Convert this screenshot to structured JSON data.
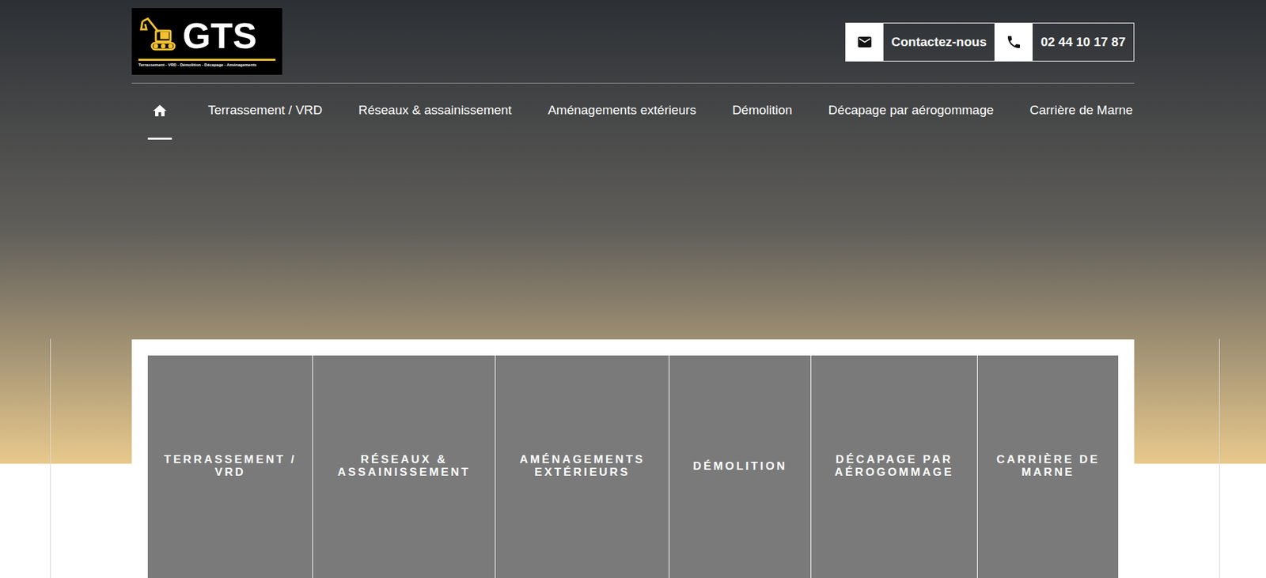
{
  "logo": {
    "name": "GTS",
    "tagline": "Terrassement - VRD - Démolition - Décapage - Aménagements"
  },
  "contact": {
    "email_label": "Contactez-nous",
    "phone": "02 44 10 17 87"
  },
  "nav": {
    "items": [
      {
        "kind": "home",
        "label": "",
        "selected": true
      },
      {
        "kind": "link",
        "label": "Terrassement / VRD",
        "selected": false
      },
      {
        "kind": "link",
        "label": "Réseaux & assainissement",
        "selected": false
      },
      {
        "kind": "link",
        "label": "Aménagements extérieurs",
        "selected": false
      },
      {
        "kind": "link",
        "label": "Démolition",
        "selected": false
      },
      {
        "kind": "link",
        "label": "Décapage par aérogommage",
        "selected": false
      },
      {
        "kind": "link",
        "label": "Carrière de Marne",
        "selected": false
      }
    ]
  },
  "tiles": [
    {
      "label": "TERRASSEMENT / VRD"
    },
    {
      "label": "RÉSEAUX & ASSAINISSEMENT"
    },
    {
      "label": "AMÉNAGEMENTS EXTÉRIEURS"
    },
    {
      "label": "DÉMOLITION"
    },
    {
      "label": "DÉCAPAGE PAR AÉROGOMMAGE"
    },
    {
      "label": "CARRIÈRE DE MARNE"
    }
  ]
}
